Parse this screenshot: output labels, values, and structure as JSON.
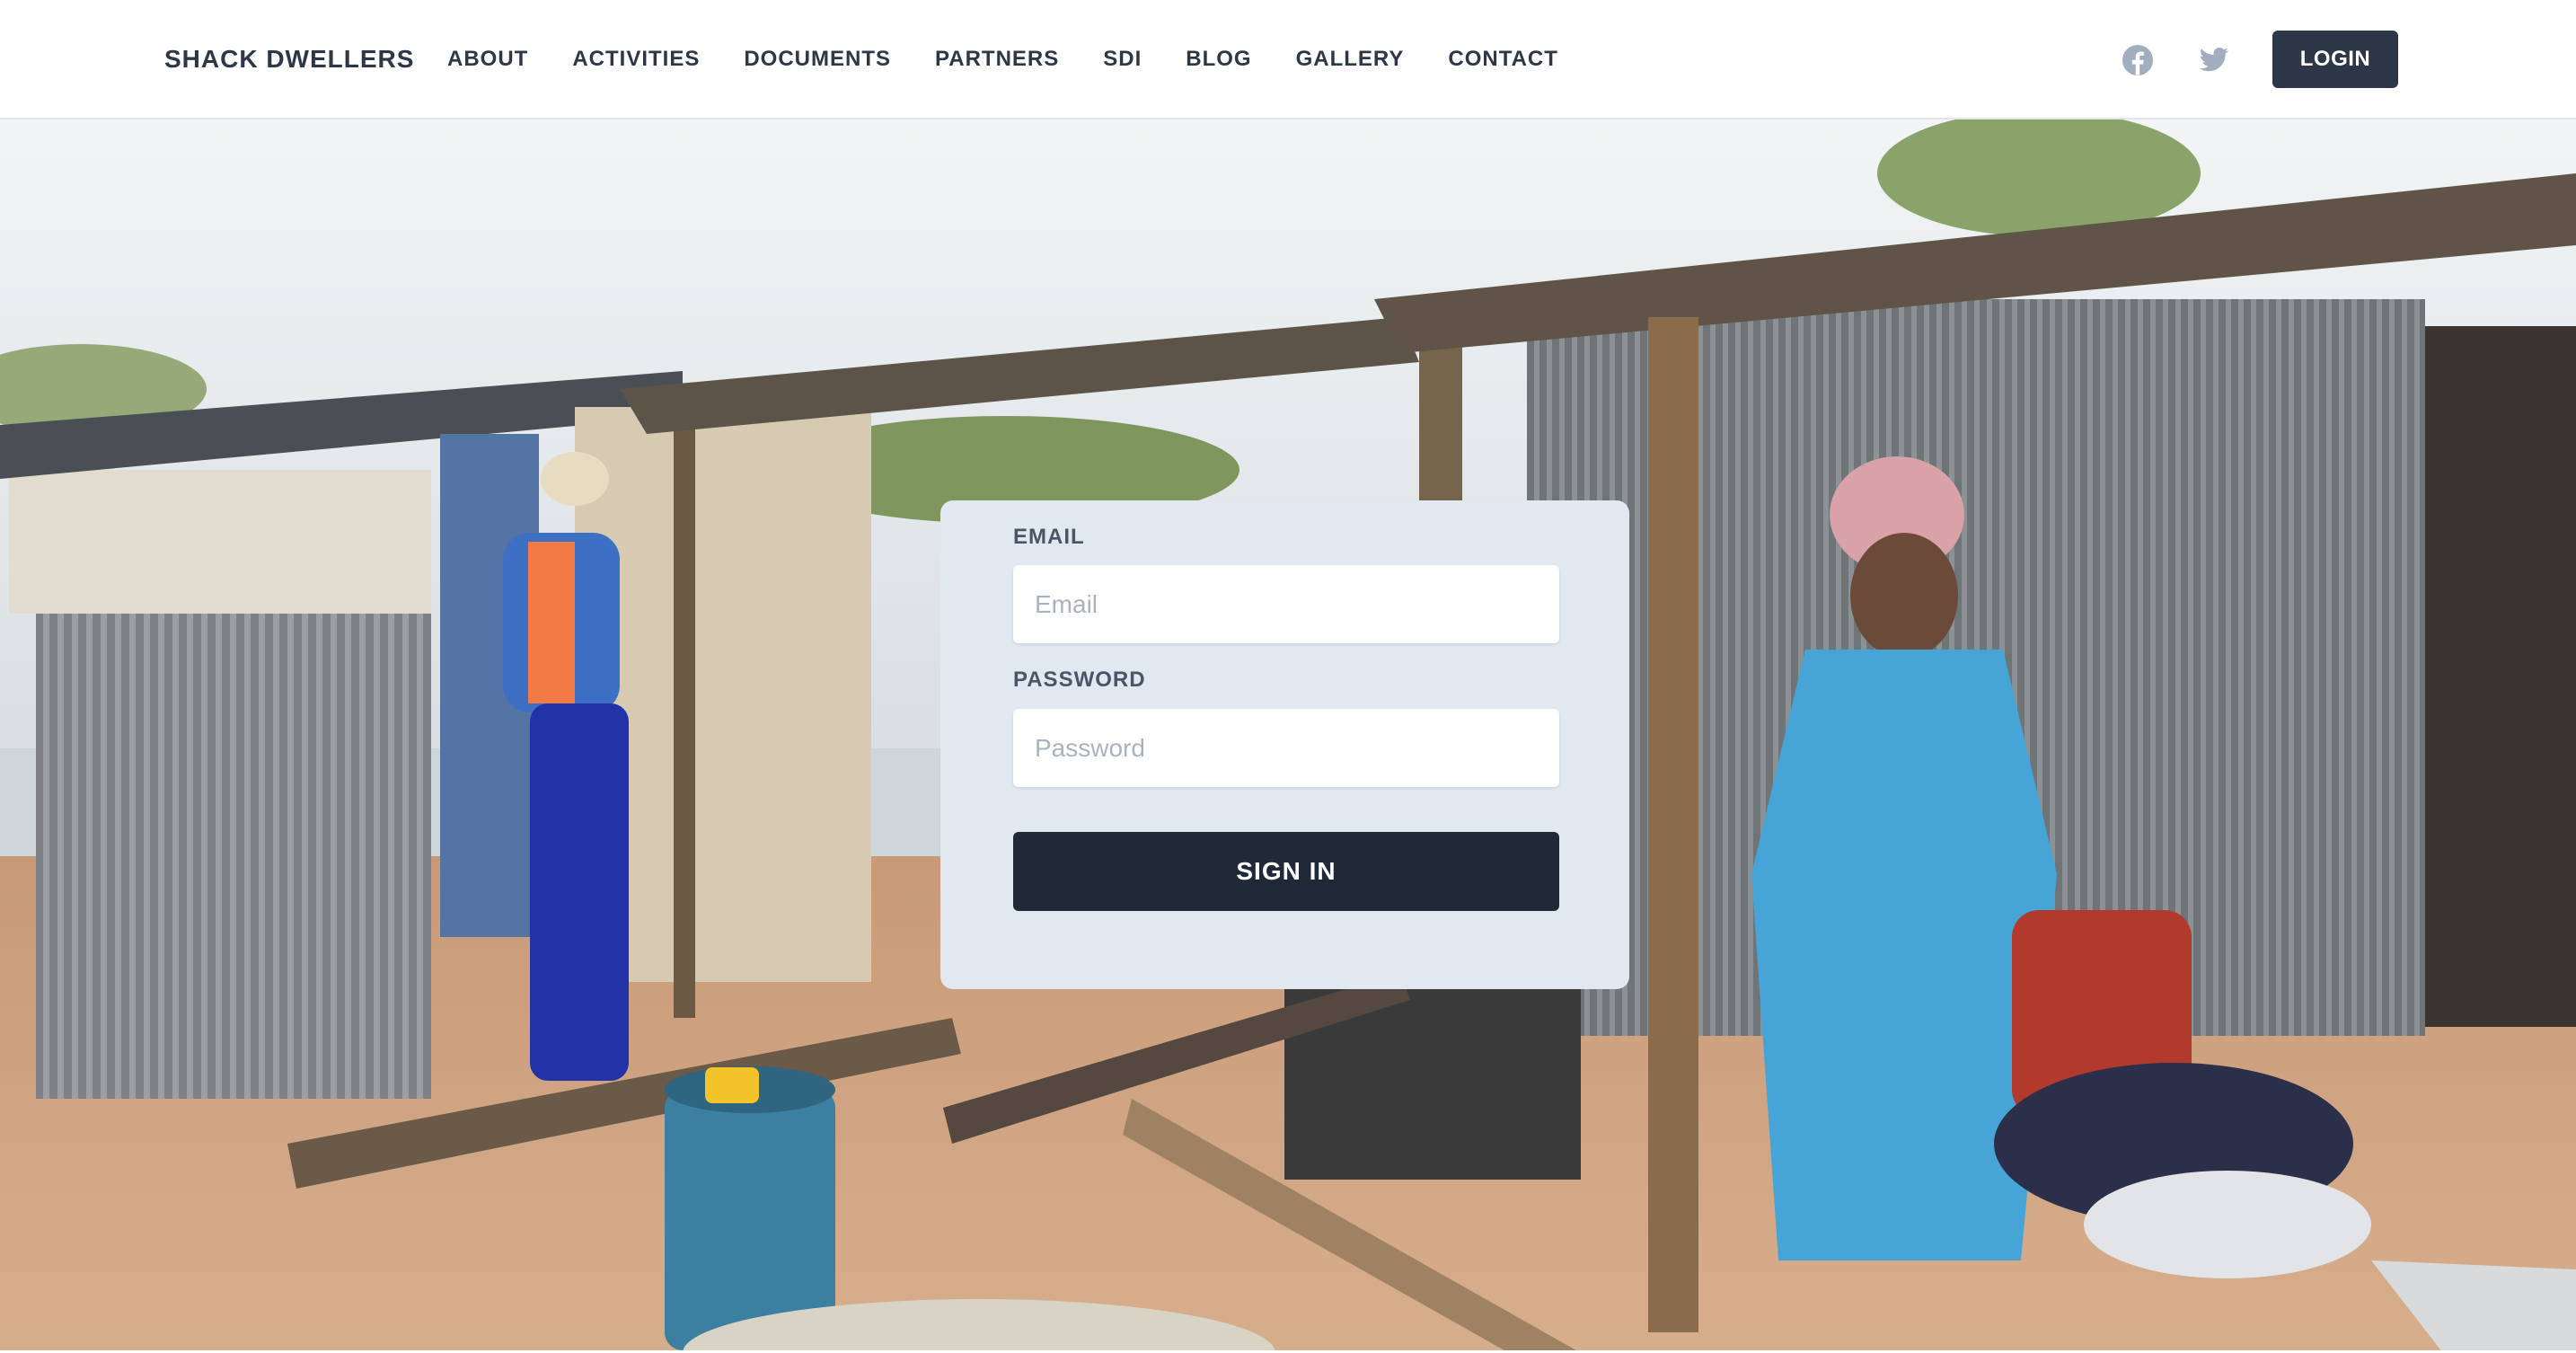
{
  "brand": {
    "name": "SHACK DWELLERS"
  },
  "nav": {
    "links": [
      "ABOUT",
      "ACTIVITIES",
      "DOCUMENTS",
      "PARTNERS",
      "SDI",
      "BLOG",
      "GALLERY",
      "CONTACT"
    ]
  },
  "social": [
    {
      "icon": "facebook-icon",
      "color": "#a0aec0"
    },
    {
      "icon": "twitter-icon",
      "color": "#a0aec0"
    }
  ],
  "header": {
    "login_label": "LOGIN"
  },
  "hero": {
    "background": "photo of corrugated-iron shacks with residents on sandy ground"
  },
  "login_form": {
    "email_label": "EMAIL",
    "email_placeholder": "Email",
    "email_value": "",
    "password_label": "PASSWORD",
    "password_placeholder": "Password",
    "password_value": "",
    "submit_label": "SIGN IN"
  },
  "colors": {
    "primary_dark": "#2d3748",
    "button_dark": "#1f2937",
    "card_bg": "#e2e8f0",
    "icon_gray": "#a0aec0"
  }
}
